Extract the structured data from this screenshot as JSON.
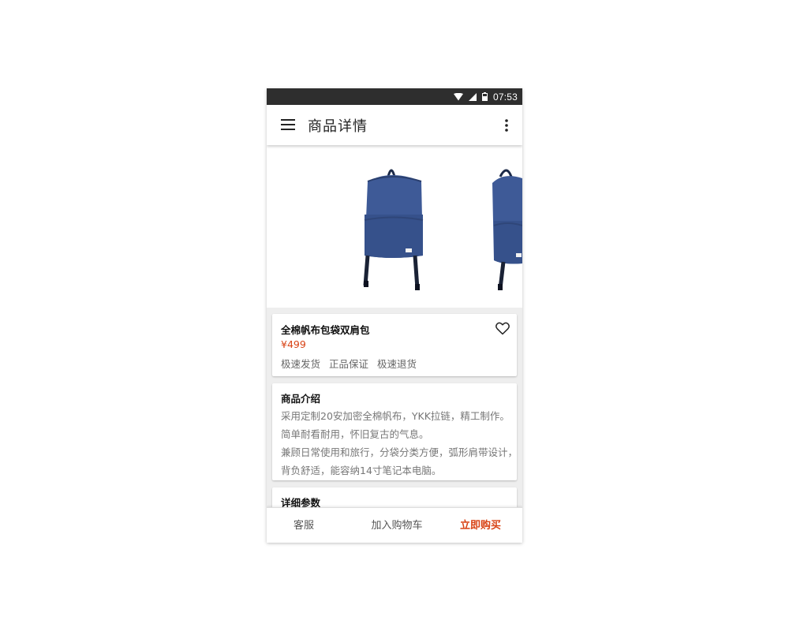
{
  "status_bar": {
    "time": "07:53"
  },
  "app_bar": {
    "title": "商品详情",
    "menu_icon": "hamburger-menu-icon",
    "more_icon": "vertical-more-icon"
  },
  "product": {
    "name": "全棉帆布包袋双肩包",
    "price": "¥499",
    "tags": [
      "极速发货",
      "正品保证",
      "极速退货"
    ],
    "favorite_icon": "heart-outline-icon",
    "image_color": "#3d5a99"
  },
  "intro": {
    "title": "商品介绍",
    "lines": [
      "采用定制20安加密全棉帆布，YKK拉链，精工制作。",
      "简单耐看耐用，怀旧复古的气息。",
      "兼顾日常使用和旅行，分袋分类方便，弧形肩带设计，",
      "背负舒适，能容纳14寸笔记本电脑。"
    ]
  },
  "params": {
    "title": "详细参数"
  },
  "bottom_bar": {
    "service": "客服",
    "add_to_cart": "加入购物车",
    "buy_now": "立即购买",
    "accent_color": "#d84315"
  }
}
